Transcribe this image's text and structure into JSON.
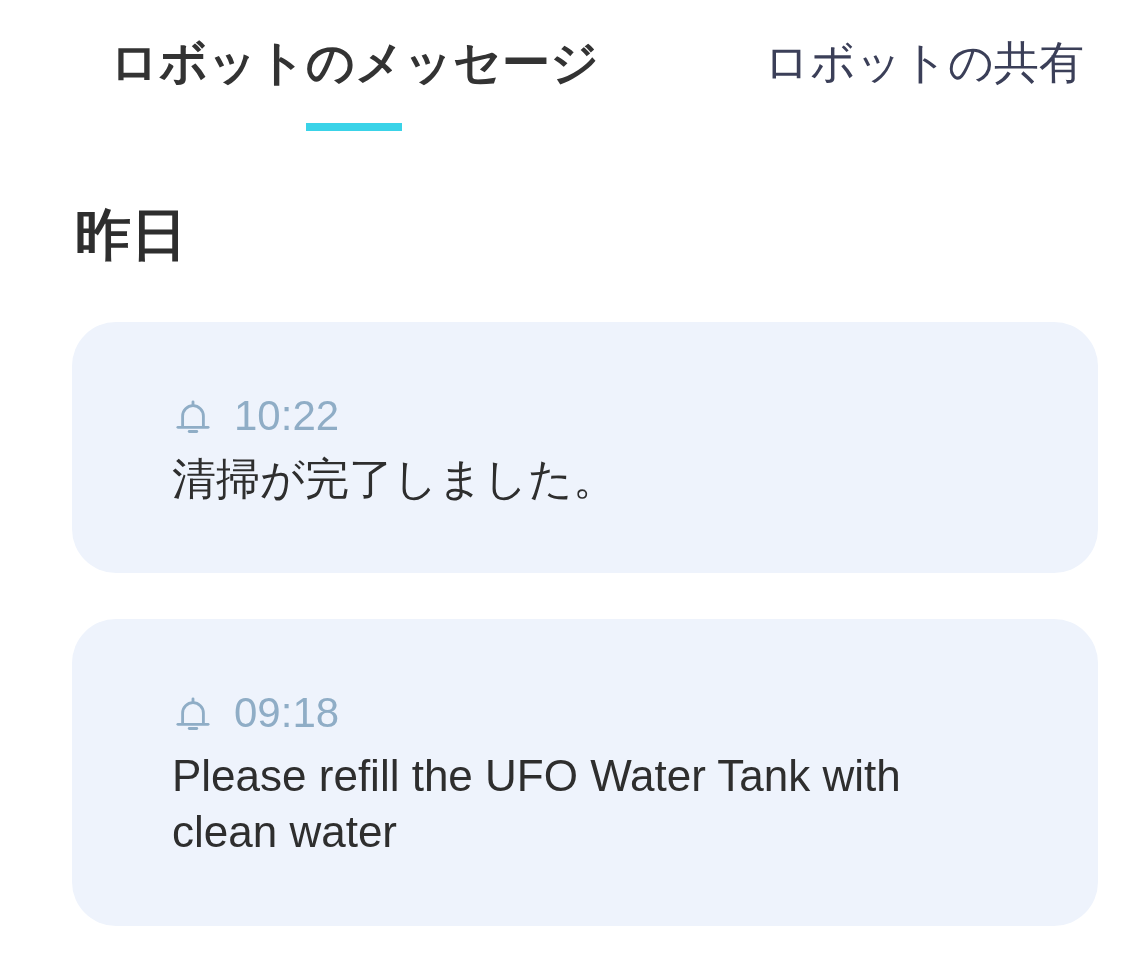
{
  "tabs": [
    {
      "label": "ロボットのメッセージ",
      "selected": true
    },
    {
      "label": "ロボットの共有",
      "selected": false
    }
  ],
  "section_heading": "昨日",
  "messages": [
    {
      "time": "10:22",
      "text": "清掃が完了しました。"
    },
    {
      "time": "09:18",
      "text": "Please refill the UFO Water Tank with clean water"
    }
  ]
}
